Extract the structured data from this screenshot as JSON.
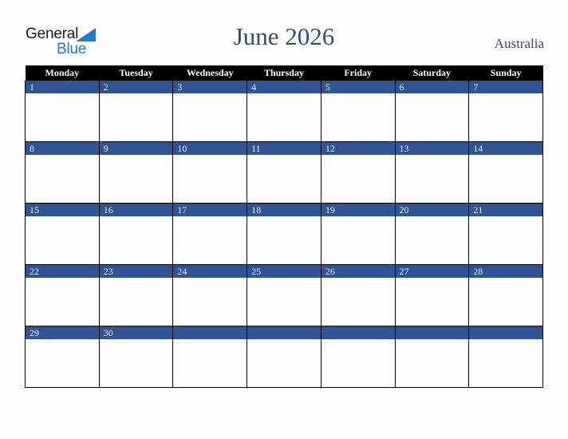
{
  "brand": {
    "name_part1": "General",
    "name_part2": "Blue",
    "triangle_color": "#1b7fd4",
    "text_color": "#1c1c1c"
  },
  "header": {
    "title": "June 2026",
    "country": "Australia",
    "title_color": "#2f4e79"
  },
  "calendar": {
    "month": "June",
    "year": "2026",
    "weekday_headers": [
      "Monday",
      "Tuesday",
      "Wednesday",
      "Thursday",
      "Friday",
      "Saturday",
      "Sunday"
    ],
    "header_bg": "#000000",
    "header_text": "#ffffff",
    "daynum_bg": "#2f5496",
    "daynum_text": "#f2f2f2",
    "cell_bg": "#fdfdfd",
    "border_color": "#000000",
    "weeks": [
      {
        "days": [
          {
            "num": "1",
            "events": ""
          },
          {
            "num": "2",
            "events": ""
          },
          {
            "num": "3",
            "events": ""
          },
          {
            "num": "4",
            "events": ""
          },
          {
            "num": "5",
            "events": ""
          },
          {
            "num": "6",
            "events": ""
          },
          {
            "num": "7",
            "events": ""
          }
        ]
      },
      {
        "days": [
          {
            "num": "8",
            "events": ""
          },
          {
            "num": "9",
            "events": ""
          },
          {
            "num": "10",
            "events": ""
          },
          {
            "num": "11",
            "events": ""
          },
          {
            "num": "12",
            "events": ""
          },
          {
            "num": "13",
            "events": ""
          },
          {
            "num": "14",
            "events": ""
          }
        ]
      },
      {
        "days": [
          {
            "num": "15",
            "events": ""
          },
          {
            "num": "16",
            "events": ""
          },
          {
            "num": "17",
            "events": ""
          },
          {
            "num": "18",
            "events": ""
          },
          {
            "num": "19",
            "events": ""
          },
          {
            "num": "20",
            "events": ""
          },
          {
            "num": "21",
            "events": ""
          }
        ]
      },
      {
        "days": [
          {
            "num": "22",
            "events": ""
          },
          {
            "num": "23",
            "events": ""
          },
          {
            "num": "24",
            "events": ""
          },
          {
            "num": "25",
            "events": ""
          },
          {
            "num": "26",
            "events": ""
          },
          {
            "num": "27",
            "events": ""
          },
          {
            "num": "28",
            "events": ""
          }
        ]
      },
      {
        "days": [
          {
            "num": "29",
            "events": ""
          },
          {
            "num": "30",
            "events": ""
          },
          {
            "num": "",
            "events": ""
          },
          {
            "num": "",
            "events": ""
          },
          {
            "num": "",
            "events": ""
          },
          {
            "num": "",
            "events": ""
          },
          {
            "num": "",
            "events": ""
          }
        ]
      }
    ]
  }
}
